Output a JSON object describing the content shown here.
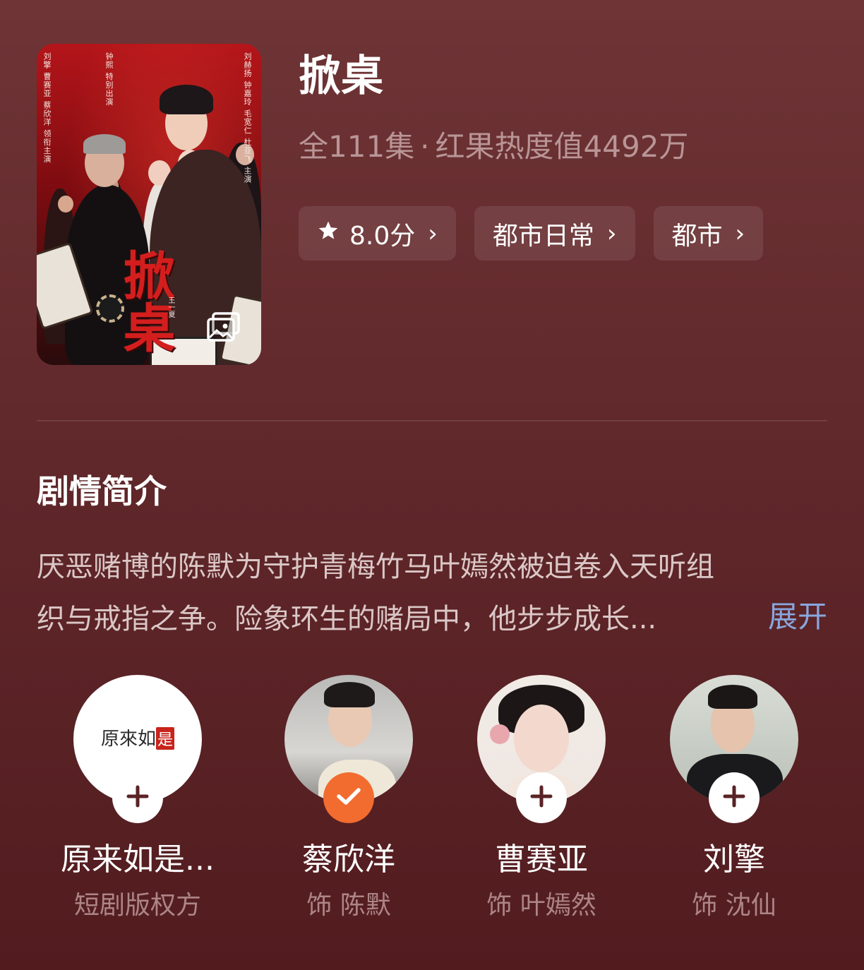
{
  "show": {
    "title": "掀桌",
    "episodes": "全111集",
    "separator": "·",
    "heat": "红果热度值4492万"
  },
  "poster": {
    "title_art": "掀桌",
    "credit_columns": [
      "刘赫扬",
      "钟嘉玲",
      "毛宽仁",
      "杜亚飞",
      "主演",
      "钟熙",
      "特别出演",
      "刘擎",
      "曹赛亚",
      "蔡欣洋",
      "领衔主演"
    ],
    "director": "王一夏",
    "gallery_icon": "gallery-icon"
  },
  "tags": [
    {
      "icon": "star-icon",
      "label": "8.0分",
      "chevron": "›"
    },
    {
      "label": "都市日常",
      "chevron": "›"
    },
    {
      "label": "都市",
      "chevron": "›"
    }
  ],
  "synopsis": {
    "heading": "剧情简介",
    "line1": "厌恶赌博的陈默为守护青梅竹马叶嫣然被迫卷入天听组",
    "line2": "织与戒指之争。险象环生的赌局中，他步步成长...",
    "expand": "展开"
  },
  "cast": [
    {
      "name": "原来如是...",
      "role": "短剧版权方",
      "logo_text": "原來如",
      "logo_seal": "是",
      "followed": false,
      "icon": "plus-icon"
    },
    {
      "name": "蔡欣洋",
      "role": "饰 陈默",
      "followed": true,
      "icon": "check-icon"
    },
    {
      "name": "曹赛亚",
      "role": "饰 叶嫣然",
      "followed": false,
      "icon": "plus-icon"
    },
    {
      "name": "刘擎",
      "role": "饰 沈仙",
      "followed": false,
      "icon": "plus-icon"
    }
  ],
  "colors": {
    "background": "#5e2629",
    "accent_follow": "#f26c2f",
    "link": "#88a7de",
    "muted": "#b99596"
  }
}
